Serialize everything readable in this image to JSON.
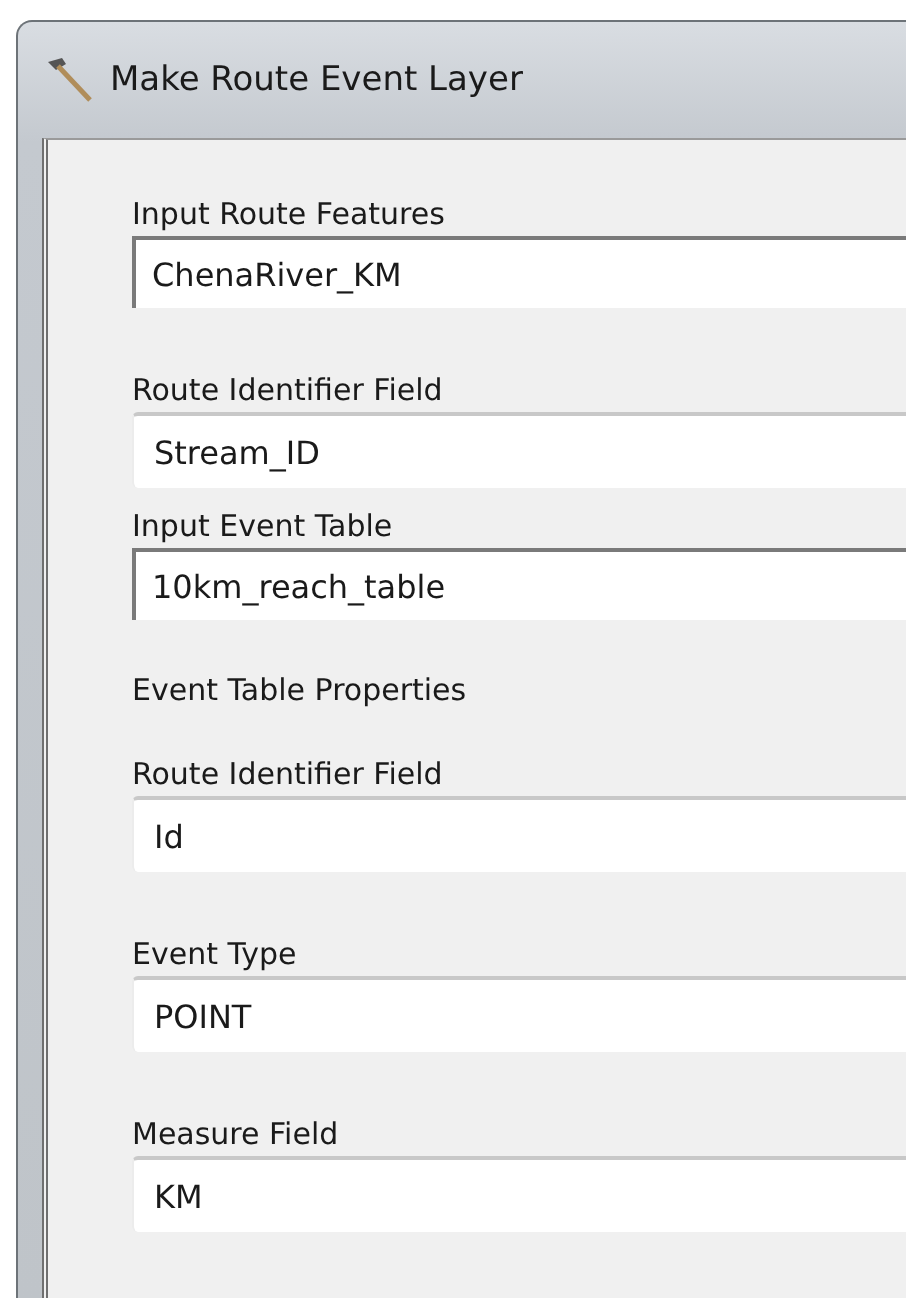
{
  "window": {
    "title": "Make Route Event Layer"
  },
  "items": [
    {
      "kind": "input",
      "label": "Input Route Features",
      "value": "ChenaRiver_KM"
    },
    {
      "kind": "combo",
      "label": "Route Identifier Field",
      "value": "Stream_ID"
    },
    {
      "kind": "input",
      "label": "Input Event Table",
      "value": "10km_reach_table"
    },
    {
      "kind": "heading",
      "label": "Event Table Properties"
    },
    {
      "kind": "combo",
      "label": "Route Identifier Field",
      "value": "Id"
    },
    {
      "kind": "combo",
      "label": "Event Type",
      "value": "POINT"
    },
    {
      "kind": "combo",
      "label": "Measure Field",
      "value": "KM"
    }
  ]
}
